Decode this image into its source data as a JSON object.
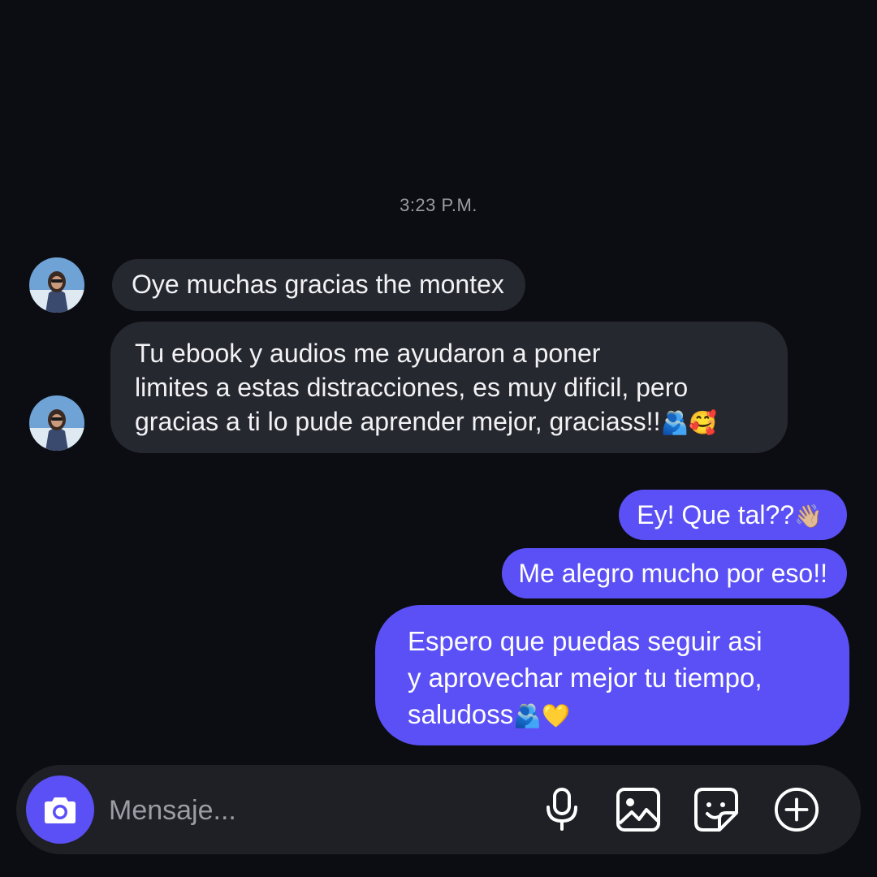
{
  "thread": {
    "timestamp": "3:23 P.M."
  },
  "messages": [
    {
      "from": "them",
      "lines": [
        "Oye muchas gracias the montex"
      ]
    },
    {
      "from": "them",
      "lines": [
        "Tu ebook y audios me ayudaron a poner",
        "limites a estas distracciones, es muy dificil, pero",
        "gracias a ti lo pude aprender mejor, graciass!!"
      ],
      "emoji": "🫂🥰"
    },
    {
      "from": "me",
      "lines": [
        "Ey! Que tal??"
      ],
      "emoji": "👋🏼"
    },
    {
      "from": "me",
      "lines": [
        "Me alegro mucho por eso!!"
      ]
    },
    {
      "from": "me",
      "lines": [
        "Espero que puedas seguir asi",
        "y aprovechar mejor tu tiempo,",
        "saludoss"
      ],
      "emoji": "🫂💛"
    }
  ],
  "composer": {
    "placeholder": "Mensaje...",
    "icons": [
      "camera-icon",
      "microphone-icon",
      "gallery-icon",
      "sticker-icon",
      "plus-circle-icon"
    ]
  },
  "colors": {
    "background": "#0c0d12",
    "received_bubble": "#262830",
    "sent_bubble": "#5b50f5",
    "composer": "#1e2026",
    "timestamp_text": "#9a9ca3"
  }
}
